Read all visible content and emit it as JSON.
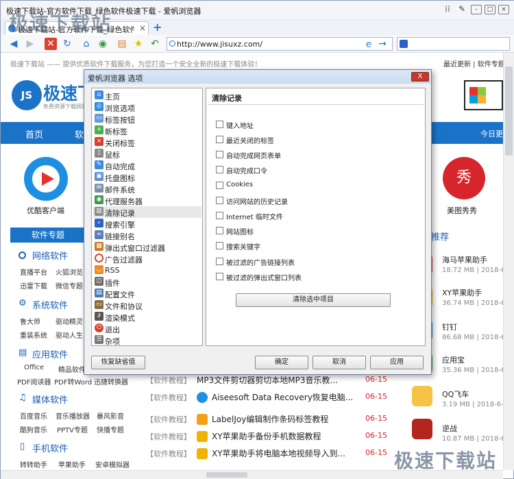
{
  "window": {
    "title": "极速下载站-官方软件下载_绿色软件极速下载 - 爱帆浏览器"
  },
  "tab": {
    "label": "极速下载站-官方软件下载_绿色软件极..."
  },
  "nav": {
    "url": "http://www.jisuxz.com/"
  },
  "page": {
    "tagline": "极速下载站 —— 提供优质软件下载服务，为您打造一个安全全新的极速下载体验！",
    "top_links": "最近更新 | 软件专题",
    "logo": "极速下",
    "logo_sub": "免费资源下载网站",
    "nav_home": "首页",
    "nav_soft": "软",
    "nav_today": "今日更",
    "app_left": "优酷客户端",
    "app_right": "美图秀秀",
    "special_btn": "软件专题",
    "recommend": "推荐",
    "sections": [
      {
        "title": "网络软件",
        "items": [
          "直播平台",
          "火狐浏览",
          "迅雷下载",
          "微信专题"
        ]
      },
      {
        "title": "系统软件",
        "items": [
          "鲁大师",
          "驱动精灵",
          "重装系统",
          "驱动人生"
        ]
      },
      {
        "title": "应用软件",
        "items": [
          "Office",
          "精品软件",
          "PDF阅读器",
          "PDF转Word",
          "迅捷转换器"
        ]
      },
      {
        "title": "媒体软件",
        "items": [
          "百度音乐",
          "音乐播放器",
          "暴风影音",
          "酷狗音乐",
          "PPTV专题",
          "快播专题"
        ]
      },
      {
        "title": "手机软件",
        "items": [
          "转转助手",
          "苹果助手",
          "安卓模拟器"
        ]
      }
    ],
    "articles": [
      {
        "cat": "【软件教程】",
        "title": "MP3文件剪切器剪切本地MP3音乐教...",
        "date": "06-15"
      },
      {
        "cat": "【软件教程】",
        "title": "Aiseesoft Data Recovery恢复电脑...",
        "date": "06-15"
      },
      {
        "cat": "【软件教程】",
        "title": "LabelJoy编辑制作条码标签教程",
        "date": "06-15"
      },
      {
        "cat": "【软件教程】",
        "title": "XY苹果助手备份手机数据教程",
        "date": "06-15"
      },
      {
        "cat": "【软件教程】",
        "title": "XY苹果助手将电脑本地视频导入到...",
        "date": "06-15"
      }
    ],
    "right_list": [
      {
        "name": "海马苹果助手",
        "meta": "18.72 MB | 2018-6"
      },
      {
        "name": "XY苹果助手",
        "meta": "36.74 MB | 2018-6"
      },
      {
        "name": "钉钉",
        "meta": "86.68 MB | 2018-6"
      },
      {
        "name": "应用宝",
        "meta": "35.36 MB | 2018-6"
      },
      {
        "name": "QQ飞车",
        "meta": "3.19 MB | 2018-6-"
      },
      {
        "name": "逆战",
        "meta": "10.87 MB | 2018-6"
      }
    ],
    "watermark_top": "极速下载站",
    "watermark_bottom": "极速下载站"
  },
  "dialog": {
    "title": "爱帆浏览器 选项",
    "close": "X",
    "tree": [
      "主页",
      "浏览选项",
      "标签按钮",
      "新标签",
      "关闭标签",
      "鼠标",
      "自动完成",
      "托盘图标",
      "邮件系统",
      "代理服务器",
      "清除记录",
      "搜索引擎",
      "链接别名",
      "弹出式窗口过滤器",
      "广告过滤器",
      "RSS",
      "插件",
      "配置文件",
      "文件和协议",
      "渲染模式",
      "退出",
      "杂项"
    ],
    "selected": "清除记录",
    "panel_title": "清除记录",
    "checks": [
      "键入地址",
      "最近关闭的标签",
      "自动完成网页表单",
      "自动完成口令",
      "Cookies",
      "访问网站的历史记录",
      "Internet 临时文件",
      "网站图标",
      "搜索关键字",
      "被过滤的广告链接列表",
      "被过滤的弹出式窗口列表"
    ],
    "clear_btn": "清除选中项目",
    "restore_btn": "恢复缺省值",
    "ok_btn": "确定",
    "cancel_btn": "取消",
    "apply_btn": "应用"
  }
}
